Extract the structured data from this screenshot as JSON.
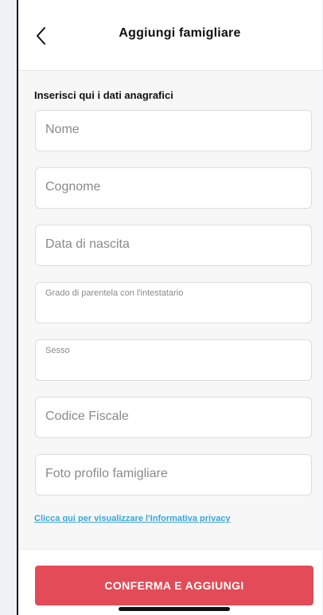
{
  "header": {
    "title": "Aggiungi famigliare",
    "back_icon": "chevron-left-icon"
  },
  "form": {
    "section_label": "Inserisci qui i dati anagrafici",
    "fields": [
      {
        "placeholder": "Nome"
      },
      {
        "placeholder": "Cognome"
      },
      {
        "placeholder": "Data di nascita"
      },
      {
        "placeholder": "Grado di parentela con l'intestatario"
      },
      {
        "placeholder": "Sesso"
      },
      {
        "placeholder": "Codice Fiscale"
      },
      {
        "placeholder": "Foto profilo famigliare"
      }
    ],
    "privacy_link": "Clicca qui per visualizzare l'Informativa privacy"
  },
  "footer": {
    "confirm_label": "CONFERMA E AGGIUNGI"
  },
  "colors": {
    "accent": "#e24b57",
    "link": "#3aa6d8",
    "background": "#f7f7f7"
  }
}
